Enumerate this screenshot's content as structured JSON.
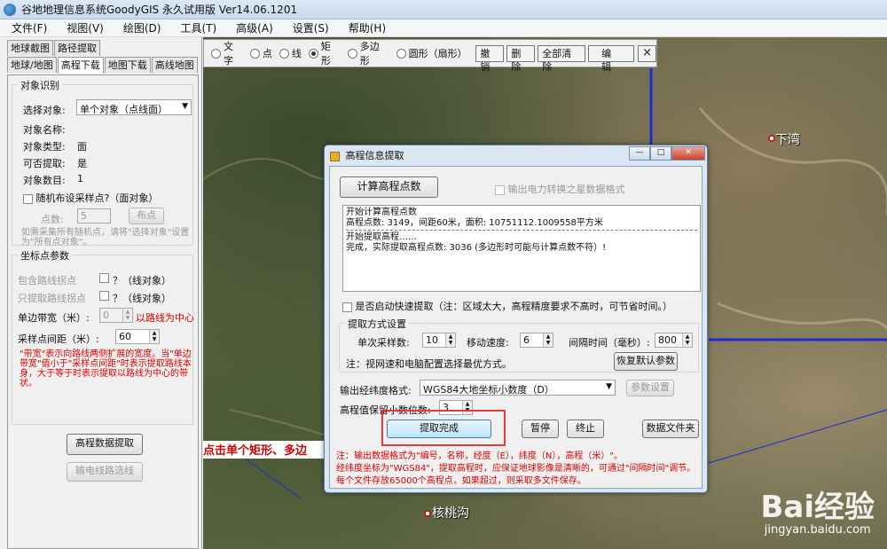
{
  "window": {
    "title": "谷地地理信息系统GoodyGIS 永久试用版 Ver14.06.1201"
  },
  "menu": [
    "文件(F)",
    "视图(V)",
    "绘图(D)",
    "工具(T)",
    "高级(A)",
    "设置(S)",
    "帮助(H)"
  ],
  "left_tabs": {
    "row1": [
      "地球截图",
      "路径提取"
    ],
    "row2": [
      "地球/地图",
      "高程下载",
      "地图下载",
      "高线地图"
    ]
  },
  "object_group": {
    "title": "对象识别",
    "select_label": "选择对象:",
    "select_value": "单个对象（点线面）",
    "name_label": "对象名称:",
    "type_label": "对象类型:",
    "type_value": "面",
    "can_extract_label": "可否提取:",
    "can_extract_value": "是",
    "count_label": "对象数目:",
    "count_value": "1",
    "random_check": "随机布设采样点?（面对象）",
    "points_label": "点数:",
    "points_value": "5",
    "place_button": "布点",
    "hint": "如需采集所有随机点，请将\"选择对象\"设置为\"所有点对象\"。"
  },
  "coord_group": {
    "title": "坐标点参数",
    "include_path_points": "包含路线拐点",
    "include_path_suffix": "？（线对象）",
    "only_path_points": "只提取路线拐点",
    "only_path_suffix": "？（线对象）",
    "width_label": "单边带宽（米）:",
    "width_value": "0",
    "width_note": "以路线为中心",
    "interval_label": "采样点间距（米）:",
    "interval_value": "60",
    "note": "\"带宽\"表示向路线两侧扩展的宽度。当\"单边带宽\"值小于\"采样点间距\"时表示提取路线本身，大于等于时表示提取以路线为中心的带状。"
  },
  "left_buttons": {
    "extract": "高程数据提取",
    "export": "输电线路选线"
  },
  "drawbar": {
    "radios": [
      "文字",
      "点",
      "线",
      "矩形",
      "多边形",
      "圆形（扇形）"
    ],
    "selected": "矩形",
    "buttons": [
      "撤销",
      "删除",
      "全部清除",
      "编辑"
    ],
    "close": "×"
  },
  "dialog": {
    "title": "高程信息提取",
    "calc_button": "计算高程点数",
    "export_check": "输出电力转换之星数据格式",
    "log": [
      "开始计算高程点数",
      "高程点数: 3149，间距60米，面积: 10751112.1009558平方米",
      "开始提取高程……",
      "完成，实际提取高程点数: 3036 (多边形时可能与计算点数不符）!"
    ],
    "fast_check": "是否启动快速提取（注：区域太大，高程精度要求不高时，可节省时间。）",
    "method_title": "提取方式设置",
    "sample_count_label": "单次采样数:",
    "sample_count_value": "10",
    "move_speed_label": "移动速度:",
    "move_speed_value": "6",
    "interval_label": "间隔时间（毫秒）:",
    "interval_value": "800",
    "speed_note": "注：视网速和电脑配置选择最优方式。",
    "restore_button": "恢复默认参数",
    "format_label": "输出经纬度格式:",
    "format_value": "WGS84大地坐标小数度（D）",
    "param_button": "参数设置",
    "decimals_label": "高程值保留小数位数:",
    "decimals_value": "3",
    "done_button": "提取完成",
    "pause_button": "暂停",
    "stop_button": "终止",
    "folder_button": "数据文件夹",
    "notes": [
      "注：输出数据格式为\"编号，名称，经度（E），纬度（N），高程（米）\"。",
      "经纬度坐标为\"WGS84\"，提取高程时，应保证地球影像是清晰的，可通过\"间隔时间\"调节。",
      "每个文件存放65000个高程点，如果超过，则采取多文件保存。"
    ]
  },
  "map_labels": {
    "xiawan": "下湾",
    "hetaogou": "核桃沟",
    "partial": "点击单个矩形、多边"
  },
  "watermark": {
    "brand": "Bai经验",
    "url": "jingyan.baidu.com"
  },
  "colors": {
    "red_note": "#d00000",
    "highlight": "#e23c3c",
    "blue_line": "#1a2bd6"
  }
}
